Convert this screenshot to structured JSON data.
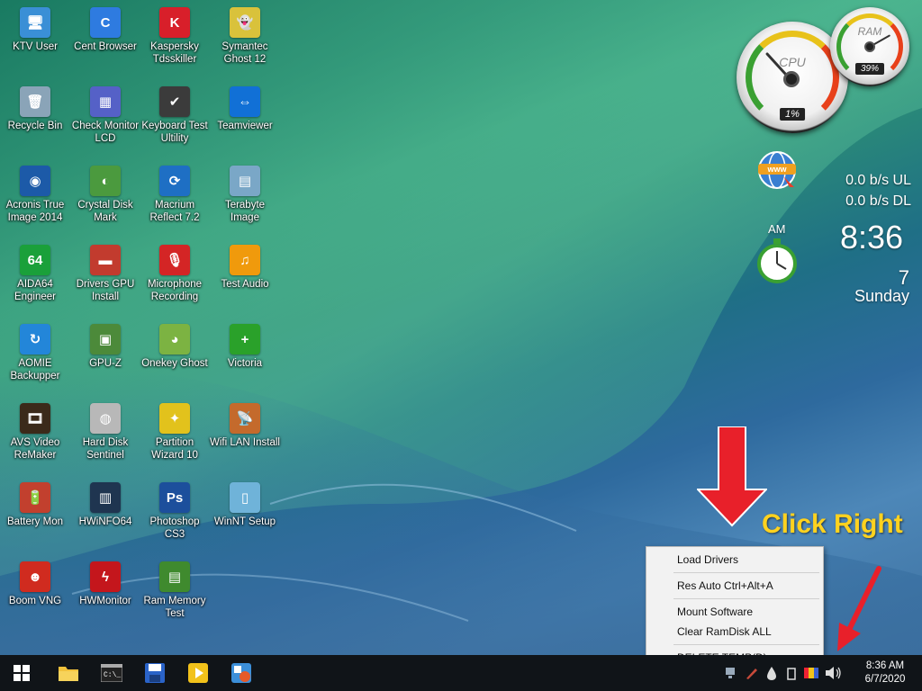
{
  "desktop": {
    "icons": [
      {
        "label": "KTV User",
        "icon": "monitor-user-icon",
        "color": "#3a8fd6",
        "glyph": "🖥"
      },
      {
        "label": "Cent Browser",
        "icon": "cent-browser-icon",
        "color": "#2e7be0",
        "glyph": "C"
      },
      {
        "label": "Kaspersky Tdsskiller",
        "icon": "kaspersky-icon",
        "color": "#d81f2a",
        "glyph": "K"
      },
      {
        "label": "Symantec Ghost 12",
        "icon": "ghost-icon",
        "color": "#d9c23b",
        "glyph": "👻"
      },
      {
        "label": "Recycle Bin",
        "icon": "recycle-bin-icon",
        "color": "#8aa4b8",
        "glyph": "🗑"
      },
      {
        "label": "Check Monitor LCD",
        "icon": "check-monitor-icon",
        "color": "#5561c7",
        "glyph": "▦"
      },
      {
        "label": "Keyboard Test Ultility",
        "icon": "keyboard-test-icon",
        "color": "#3b3b3b",
        "glyph": "✔"
      },
      {
        "label": "Teamviewer",
        "icon": "teamviewer-icon",
        "color": "#1170d6",
        "glyph": "⇔"
      },
      {
        "label": "Acronis True Image 2014",
        "icon": "acronis-icon",
        "color": "#1c5aa8",
        "glyph": "◉"
      },
      {
        "label": "Crystal Disk Mark",
        "icon": "crystal-disk-icon",
        "color": "#4b9a3e",
        "glyph": "◐"
      },
      {
        "label": "Macrium Reflect 7.2",
        "icon": "macrium-icon",
        "color": "#1e6fc4",
        "glyph": "⟳"
      },
      {
        "label": "Terabyte Image",
        "icon": "terabyte-icon",
        "color": "#7aa7c7",
        "glyph": "▤"
      },
      {
        "label": "AIDA64 Engineer",
        "icon": "aida64-icon",
        "color": "#1aa03a",
        "glyph": "64"
      },
      {
        "label": "Drivers GPU Install",
        "icon": "gpu-driver-icon",
        "color": "#c23b2e",
        "glyph": "▬"
      },
      {
        "label": "Microphone Recording",
        "icon": "microphone-icon",
        "color": "#d42525",
        "glyph": "🎙"
      },
      {
        "label": "Test Audio",
        "icon": "audio-icon",
        "color": "#f09a0c",
        "glyph": "♫"
      },
      {
        "label": "AOMIE Backupper",
        "icon": "aomei-icon",
        "color": "#2386d9",
        "glyph": "↻"
      },
      {
        "label": "GPU-Z",
        "icon": "gpuz-icon",
        "color": "#4c8a3a",
        "glyph": "▣"
      },
      {
        "label": "Onekey Ghost",
        "icon": "onekey-ghost-icon",
        "color": "#7cb342",
        "glyph": "◕"
      },
      {
        "label": "Victoria",
        "icon": "victoria-icon",
        "color": "#2aa12a",
        "glyph": "+"
      },
      {
        "label": "AVS Video ReMaker",
        "icon": "avs-video-icon",
        "color": "#3b2a1a",
        "glyph": "🎞"
      },
      {
        "label": "Hard Disk Sentinel",
        "icon": "hdd-sentinel-icon",
        "color": "#b8b8b8",
        "glyph": "◍"
      },
      {
        "label": "Partition Wizard 10",
        "icon": "partition-wizard-icon",
        "color": "#e2c21c",
        "glyph": "✦"
      },
      {
        "label": "Wifi LAN Install",
        "icon": "wifi-lan-icon",
        "color": "#c46a2c",
        "glyph": "📡"
      },
      {
        "label": "Battery Mon",
        "icon": "battery-icon",
        "color": "#c2402e",
        "glyph": "🔋"
      },
      {
        "label": "HWiNFO64",
        "icon": "hwinfo-icon",
        "color": "#1f3550",
        "glyph": "▥"
      },
      {
        "label": "Photoshop CS3",
        "icon": "photoshop-icon",
        "color": "#1c4f9c",
        "glyph": "Ps"
      },
      {
        "label": "WinNT Setup",
        "icon": "winnt-setup-icon",
        "color": "#6fb3d9",
        "glyph": "▯"
      },
      {
        "label": "Boom VNG",
        "icon": "boom-vng-icon",
        "color": "#d02b1f",
        "glyph": "☻"
      },
      {
        "label": "HWMonitor",
        "icon": "hwmonitor-icon",
        "color": "#c4161c",
        "glyph": "ϟ"
      },
      {
        "label": "Ram Memory Test",
        "icon": "ram-test-icon",
        "color": "#3f8a2e",
        "glyph": "▤"
      }
    ]
  },
  "widgets": {
    "cpu": {
      "name": "CPU",
      "value": "1%",
      "percent": 1
    },
    "ram": {
      "name": "RAM",
      "value": "39%",
      "percent": 39
    },
    "network": {
      "ul": "0.0 b/s  UL",
      "dl": "0.0 b/s  DL"
    },
    "clock": {
      "ampm": "AM",
      "time": "8:36",
      "day": "7",
      "weekday": "Sunday"
    }
  },
  "annotation": {
    "text": "Click Right",
    "arrow_color": "#e8202a"
  },
  "context_menu": {
    "items": [
      {
        "label": "Load Drivers"
      },
      {
        "label": "Res Auto Ctrl+Alt+A"
      },
      {
        "label": "Mount Software"
      },
      {
        "label": "Clear RamDisk ALL"
      },
      {
        "label": "DELETE TEMP(D)..."
      }
    ]
  },
  "taskbar": {
    "pinned": [
      "start-windows-icon",
      "file-explorer-icon",
      "cmd-icon",
      "save-disk-icon",
      "player-icon",
      "setup-app-icon"
    ],
    "tray": [
      "network-tray-icon",
      "pen-tray-icon",
      "droplet-tray-icon",
      "usb-tray-icon",
      "color-tray-icon",
      "volume-icon"
    ],
    "time": "8:36 AM",
    "date": "6/7/2020"
  }
}
